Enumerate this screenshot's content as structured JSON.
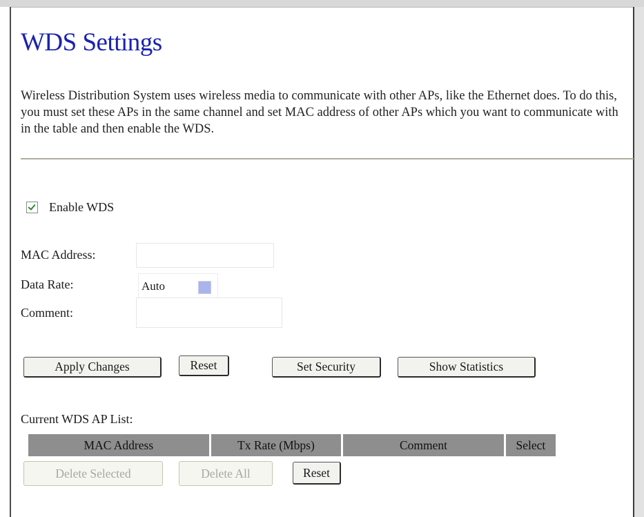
{
  "page": {
    "title": "WDS Settings",
    "description": "Wireless Distribution System uses wireless media to communicate with other APs, like the Ethernet does. To do this, you must set these APs in the same channel and set MAC address of other APs which you want to communicate with in the table and then enable the WDS."
  },
  "enable_wds": {
    "label": "Enable WDS",
    "checked": true
  },
  "form": {
    "mac_label": "MAC Address:",
    "mac_value": "",
    "rate_label": "Data Rate:",
    "rate_value": "Auto",
    "comment_label": "Comment:",
    "comment_value": ""
  },
  "buttons": {
    "apply": "Apply Changes",
    "reset": "Reset",
    "set_security": "Set Security",
    "show_statistics": "Show Statistics"
  },
  "ap_list": {
    "title": "Current WDS AP List:",
    "columns": [
      "MAC Address",
      "Tx Rate (Mbps)",
      "Comment",
      "Select"
    ],
    "rows": []
  },
  "list_buttons": {
    "delete_selected": "Delete Selected",
    "delete_all": "Delete All",
    "reset": "Reset"
  },
  "colors": {
    "title": "#1a22b0",
    "table_header": "#8e8e8e",
    "select_arrow": "#a9b4ea"
  }
}
